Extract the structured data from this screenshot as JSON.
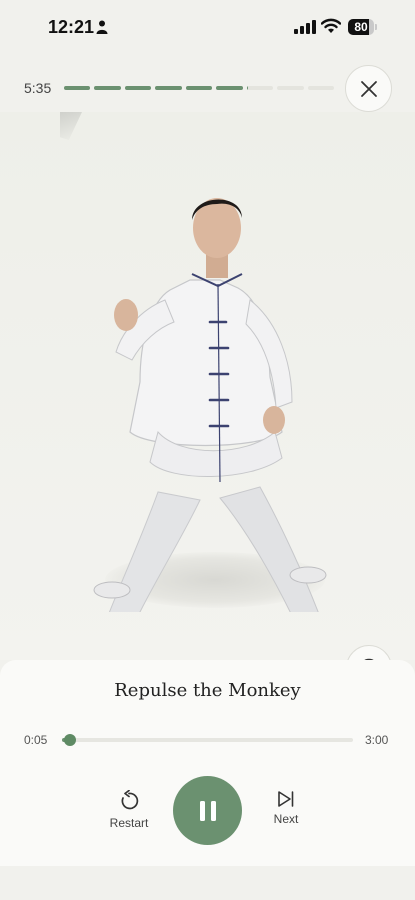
{
  "status_bar": {
    "time": "12:21",
    "battery": "80",
    "battery_level": 0.8,
    "icons": [
      "person-icon",
      "signal-icon",
      "wifi-icon",
      "battery-icon"
    ]
  },
  "session": {
    "total_time": "5:35",
    "segment_count": 9,
    "segments_completed": 6,
    "current_segment_progress": 0.05
  },
  "move": {
    "title": "Repulse the Monkey",
    "elapsed": "0:05",
    "duration": "3:00",
    "progress": 0.028
  },
  "controls": {
    "restart_label": "Restart",
    "next_label": "Next",
    "play_state": "playing"
  },
  "colors": {
    "accent": "#6b9170",
    "background": "#f1f1ed",
    "panel": "#fafaf8"
  },
  "icons": [
    "close-icon",
    "info-icon",
    "more-icon",
    "restart-icon",
    "pause-icon",
    "skip-next-icon"
  ]
}
